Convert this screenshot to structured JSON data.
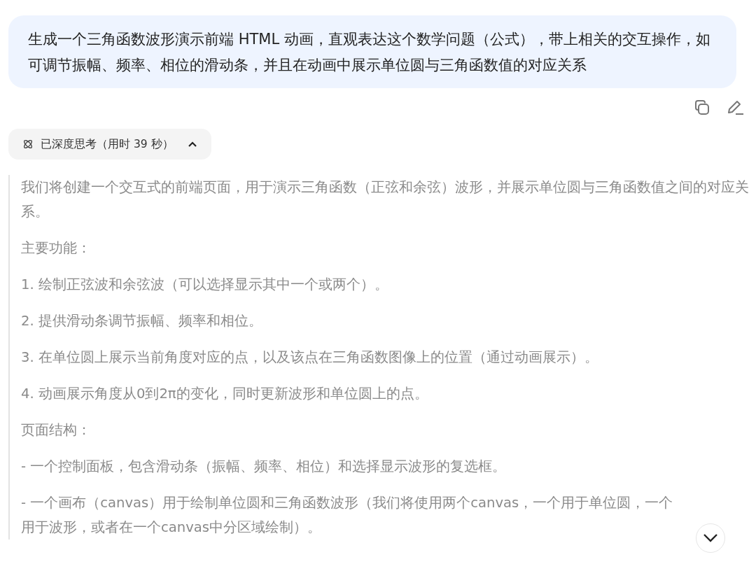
{
  "user_message": {
    "text": "生成一个三角函数波形演示前端 HTML 动画，直观表达这个数学问题（公式），带上相关的交互操作，如可调节振幅、频率、相位的滑动条，并且在动画中展示单位圆与三角函数值的对应关系"
  },
  "thinking": {
    "label": "已深度思考（用时 39 秒）",
    "expanded": true,
    "paragraphs": [
      "我们将创建一个交互式的前端页面，用于演示三角函数（正弦和余弦）波形，并展示单位圆与三角函数值之间的对应关系。",
      "主要功能：",
      "1. 绘制正弦波和余弦波（可以选择显示其中一个或两个）。",
      "2. 提供滑动条调节振幅、频率和相位。",
      "3. 在单位圆上展示当前角度对应的点，以及该点在三角函数图像上的位置（通过动画展示）。",
      "4. 动画展示角度从0到2π的变化，同时更新波形和单位圆上的点。",
      "页面结构：",
      "- 一个控制面板，包含滑动条（振幅、频率、相位）和选择显示波形的复选框。",
      "- 一个画布（canvas）用于绘制单位圆和三角函数波形（我们将使用两个canvas，一个用于单位圆，一个用于波形，或者在一个canvas中分区域绘制）。"
    ]
  }
}
